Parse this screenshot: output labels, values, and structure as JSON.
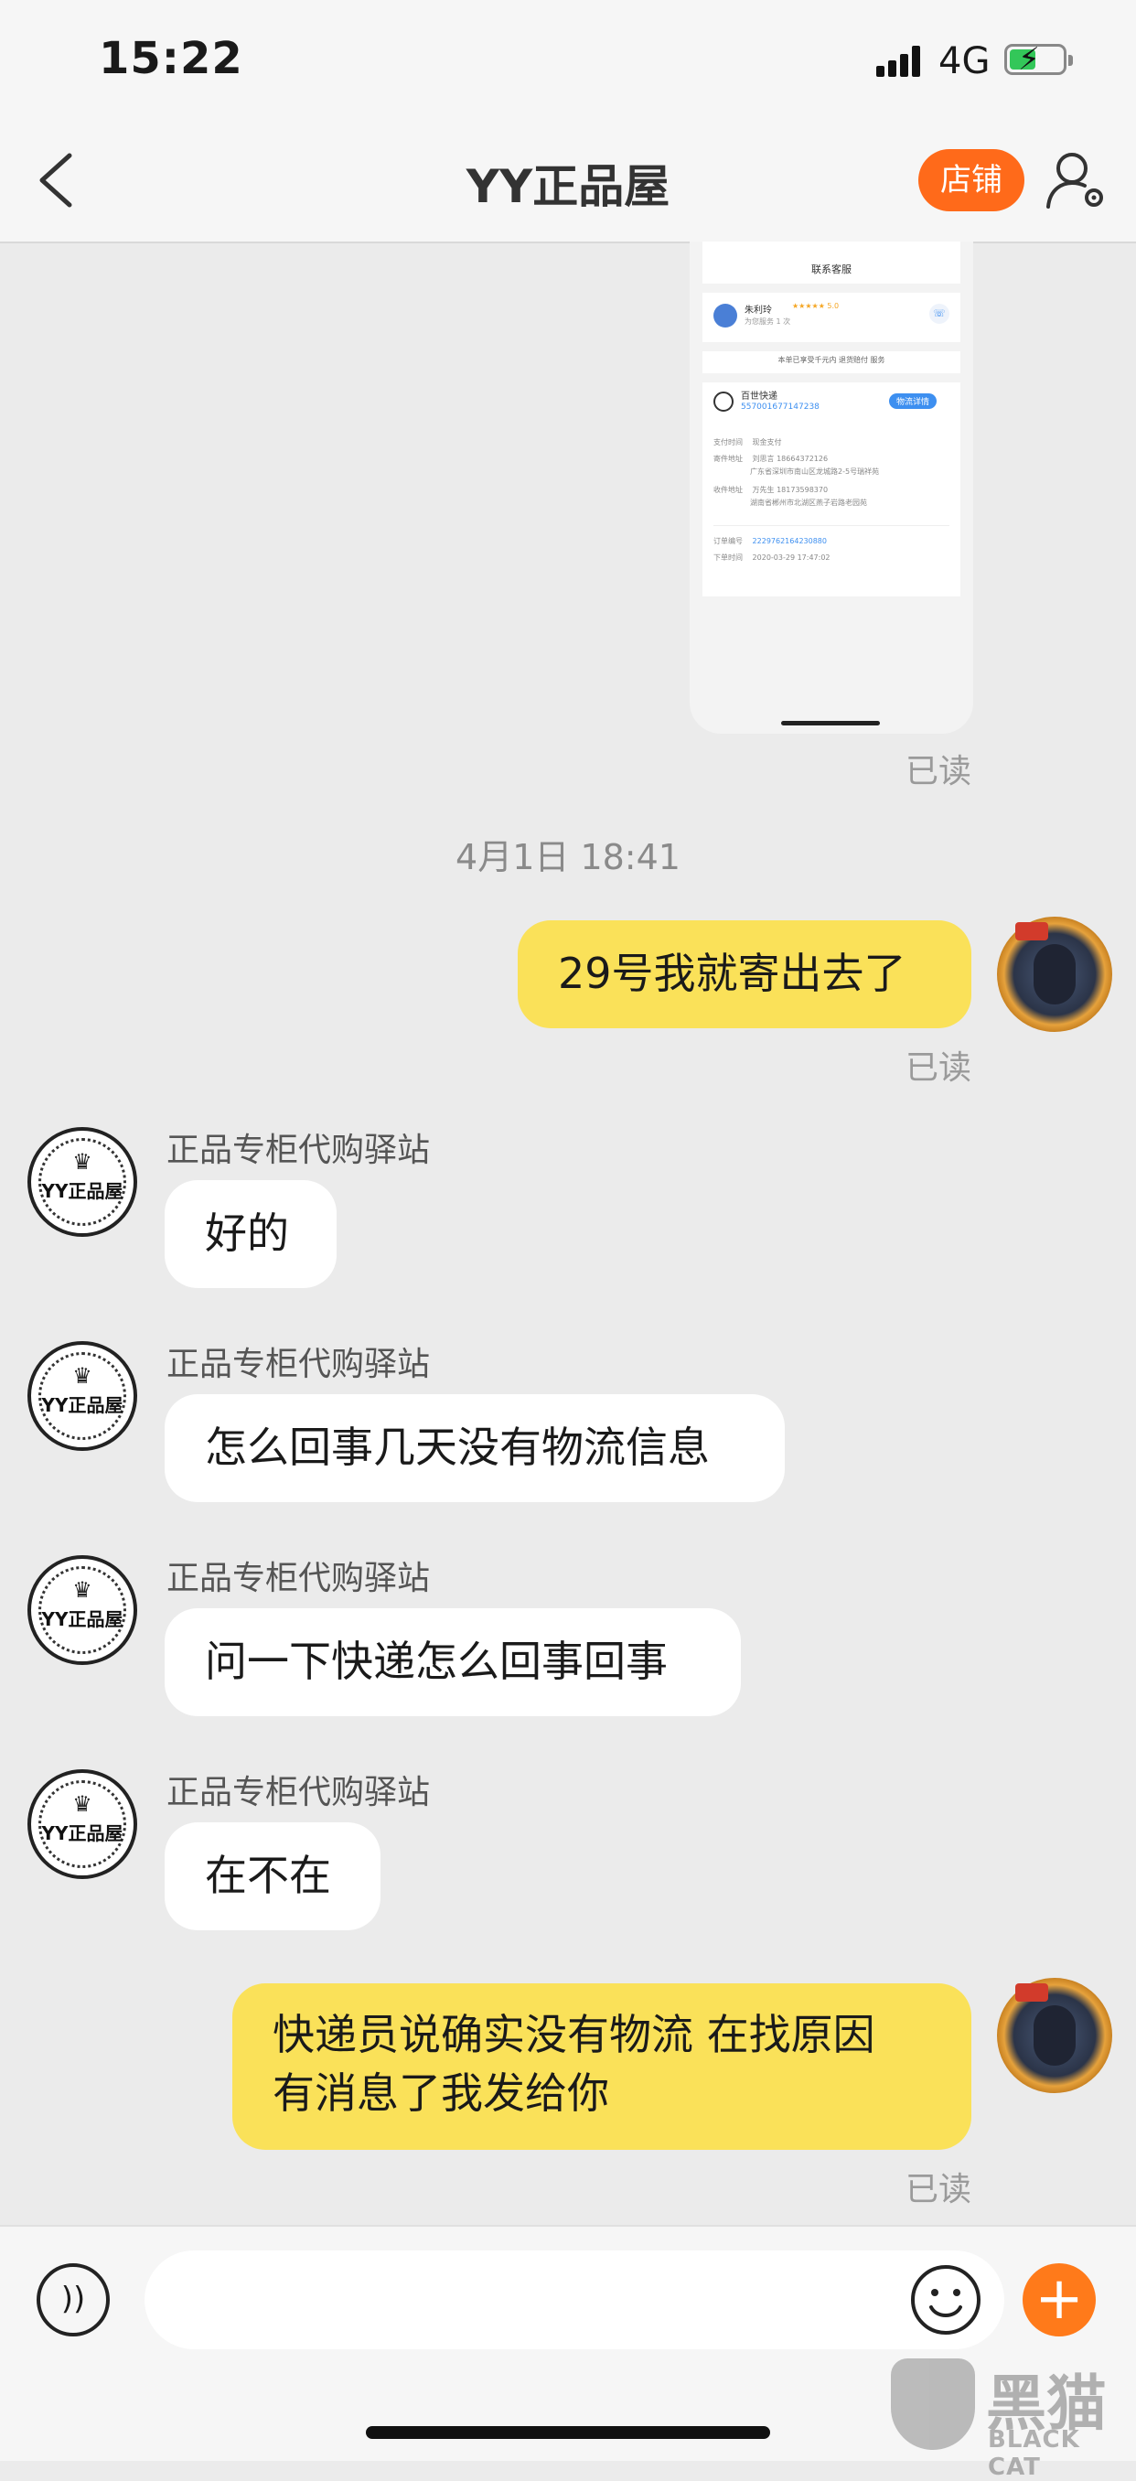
{
  "status_bar": {
    "time": "15:22",
    "network": "4G"
  },
  "header": {
    "title": "YY正品屋",
    "shop_label": "店铺"
  },
  "card": {
    "top_text": "联系客服",
    "agent_name": "朱利玲",
    "agent_sub": "为您服务 1 次",
    "agent_rating": "★★★★★ 5.0",
    "insurance_text": "本单已享受千元内 退货赔付 服务",
    "courier": "百世快递",
    "tracking": "557001677147238",
    "track_btn": "物流详情",
    "pay_label": "支付时间",
    "pay_value": "现金支付",
    "sender_label": "寄件地址",
    "sender_value": "刘思言 18664372126",
    "sender_addr": "广东省深圳市南山区龙城路2-5号瑞祥苑",
    "recv_label": "收件地址",
    "recv_value": "万先生 18173598370",
    "recv_addr": "湖南省郴州市北湖区燕子岩路老园苑",
    "order_label": "订单编号",
    "order_value": "2229762164230880",
    "time_label": "下单时间",
    "time_value": "2020-03-29 17:47:02"
  },
  "messages": {
    "read_label": "已读",
    "timestamp": "4月1日 18:41",
    "sender_name": "正品专柜代购驿站",
    "shop_avatar_text": "YY正品屋",
    "m1": "29号我就寄出去了",
    "m2": "好的",
    "m3": "怎么回事几天没有物流信息",
    "m4": "问一下快递怎么回事回事",
    "m5": "在不在",
    "m6_line1": "快递员说确实没有物流 在找原因",
    "m6_line2": "有消息了我发给你"
  },
  "input": {
    "placeholder": ""
  },
  "watermark": {
    "cn": "黑猫",
    "en": "BLACK CAT"
  },
  "colors": {
    "accent": "#ff6a1a",
    "my_bubble": "#fae159",
    "their_bubble": "#ffffff",
    "bg": "#ebebeb"
  }
}
